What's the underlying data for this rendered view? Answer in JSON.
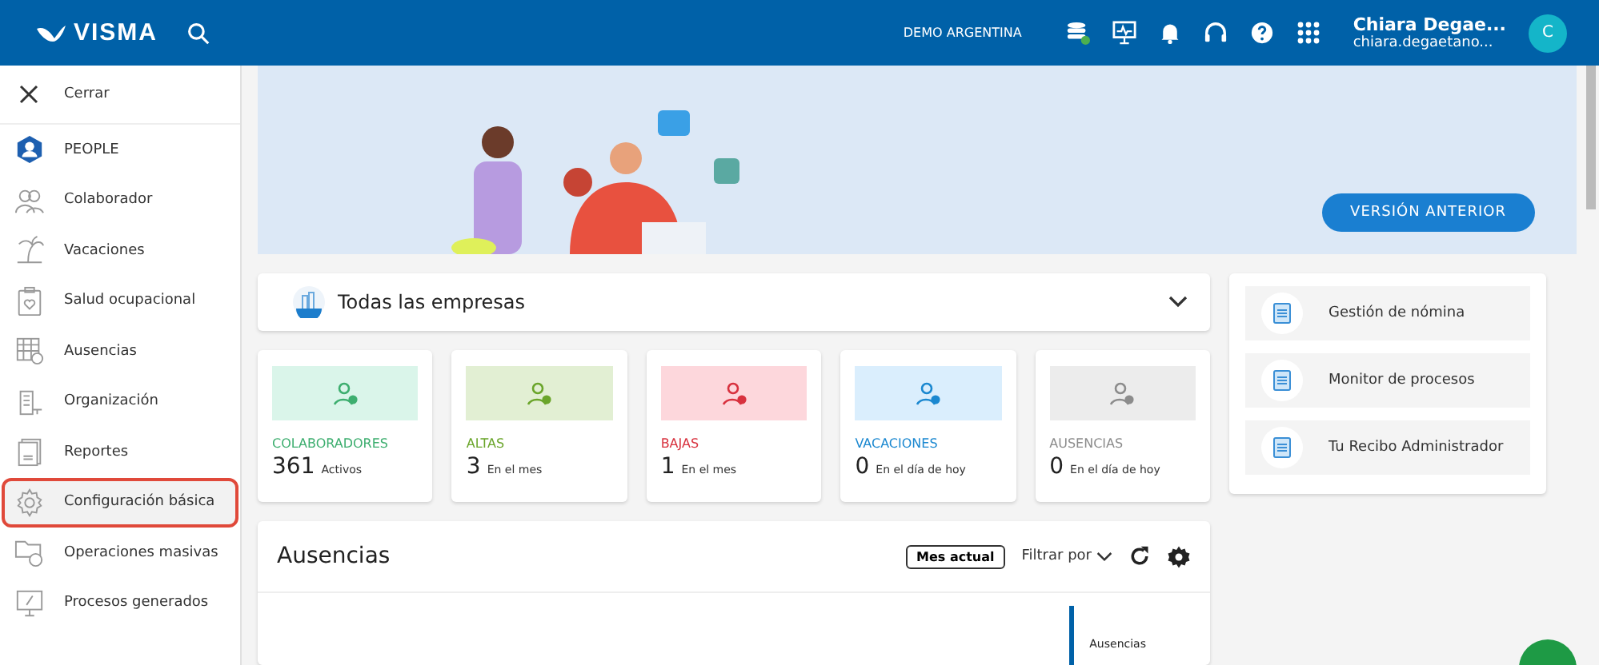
{
  "header": {
    "brand": "VISMA",
    "company": "DEMO ARGENTINA",
    "user": {
      "name": "Chiara Degae...",
      "email": "chiara.degaetano...",
      "initial": "C"
    }
  },
  "sidebar": {
    "close_label": "Cerrar",
    "items": [
      {
        "label": "PEOPLE",
        "kind": "app",
        "selected": false
      },
      {
        "label": "Colaborador",
        "kind": "people",
        "selected": false
      },
      {
        "label": "Vacaciones",
        "kind": "palm",
        "selected": false
      },
      {
        "label": "Salud ocupacional",
        "kind": "clipboard",
        "selected": false
      },
      {
        "label": "Ausencias",
        "kind": "calendar",
        "selected": false
      },
      {
        "label": "Organización",
        "kind": "building",
        "selected": false
      },
      {
        "label": "Reportes",
        "kind": "report",
        "selected": false
      },
      {
        "label": "Configuración básica",
        "kind": "gear",
        "selected": true
      },
      {
        "label": "Operaciones masivas",
        "kind": "folders",
        "selected": false
      },
      {
        "label": "Procesos generados",
        "kind": "monitor",
        "selected": false
      }
    ]
  },
  "banner": {
    "button": "VERSIÓN ANTERIOR"
  },
  "company_selector": {
    "label": "Todas las empresas"
  },
  "stats": [
    {
      "title": "COLABORADORES",
      "value": "361",
      "caption": "Activos",
      "color": "#3dae6f"
    },
    {
      "title": "ALTAS",
      "value": "3",
      "caption": "En el mes",
      "color": "#6aa52a"
    },
    {
      "title": "BAJAS",
      "value": "1",
      "caption": "En el mes",
      "color": "#d8313e"
    },
    {
      "title": "VACACIONES",
      "value": "0",
      "caption": "En el día de hoy",
      "color": "#1b88d0"
    },
    {
      "title": "AUSENCIAS",
      "value": "0",
      "caption": "En el día de hoy",
      "color": "#8c8c8c"
    }
  ],
  "shortcuts": [
    {
      "label": "Gestión de nómina"
    },
    {
      "label": "Monitor de procesos"
    },
    {
      "label": "Tu Recibo Administrador"
    }
  ],
  "absences": {
    "title": "Ausencias",
    "period_button": "Mes actual",
    "filter": "Filtrar por",
    "legend": "Ausencias"
  }
}
